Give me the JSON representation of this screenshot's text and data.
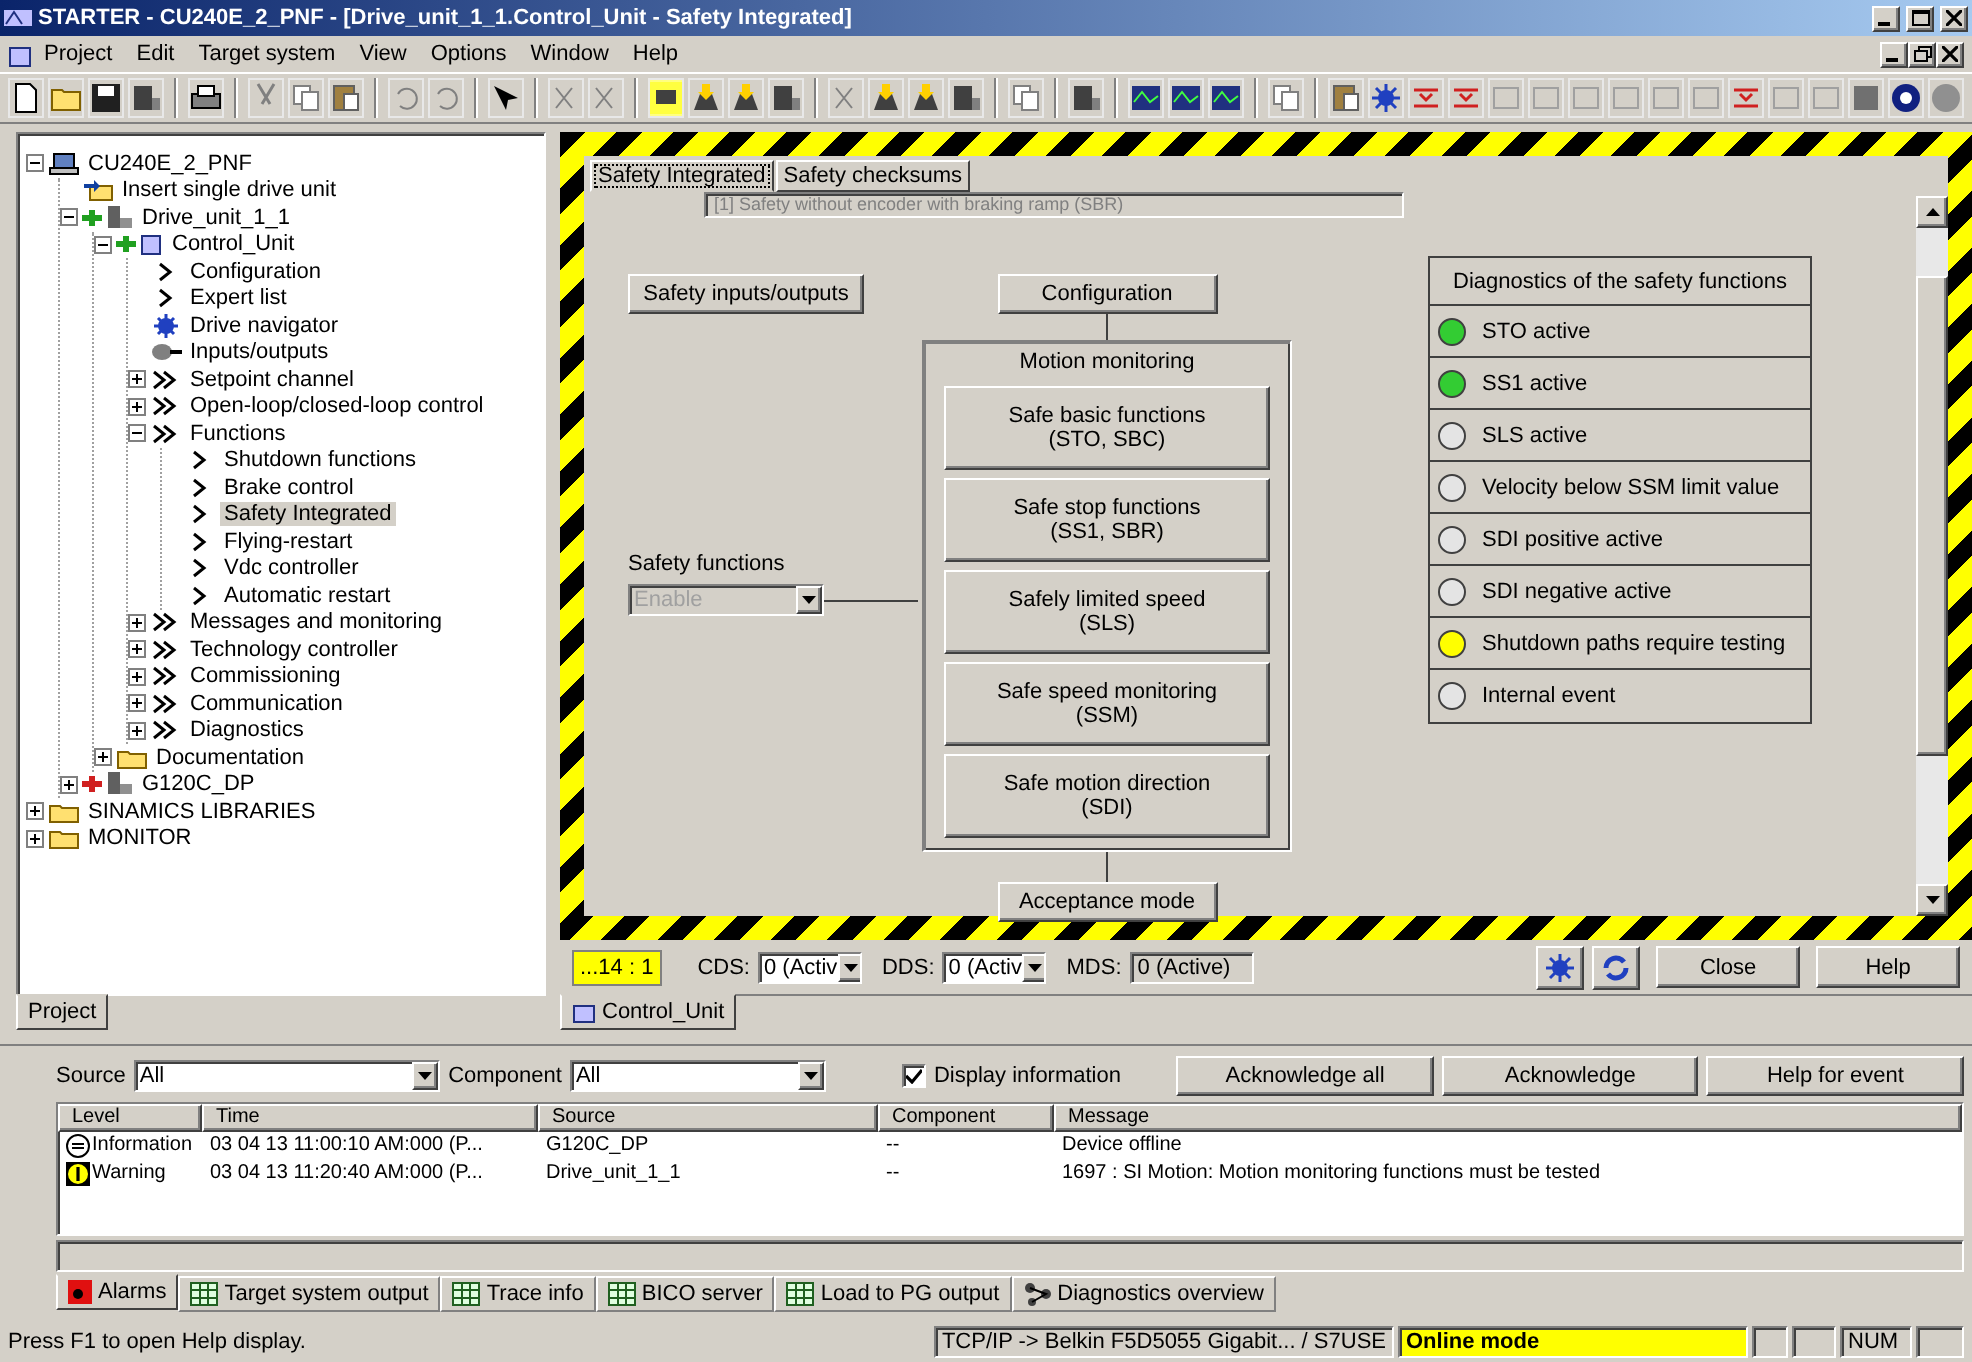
{
  "window": {
    "title": "STARTER - CU240E_2_PNF - [Drive_unit_1_1.Control_Unit - Safety Integrated]"
  },
  "menu": [
    "Project",
    "Edit",
    "Target system",
    "View",
    "Options",
    "Window",
    "Help"
  ],
  "project_tree": {
    "items": [
      {
        "label": "CU240E_2_PNF",
        "kind": "computer",
        "expanded": true,
        "selected": false,
        "children": [
          {
            "label": "Insert single drive unit",
            "kind": "insert",
            "selected": false
          },
          {
            "label": "Drive_unit_1_1",
            "kind": "drive",
            "expanded": true,
            "selected": false,
            "children": [
              {
                "label": "Control_Unit",
                "kind": "control",
                "expanded": true,
                "selected": false,
                "children": [
                  {
                    "label": "Configuration",
                    "kind": "arrow",
                    "selected": false
                  },
                  {
                    "label": "Expert list",
                    "kind": "arrow",
                    "selected": false
                  },
                  {
                    "label": "Drive navigator",
                    "kind": "navigator",
                    "selected": false
                  },
                  {
                    "label": "Inputs/outputs",
                    "kind": "io",
                    "selected": false
                  },
                  {
                    "label": "Setpoint channel",
                    "kind": "double",
                    "expanded": false,
                    "selected": false
                  },
                  {
                    "label": "Open-loop/closed-loop control",
                    "kind": "double",
                    "expanded": false,
                    "selected": false
                  },
                  {
                    "label": "Functions",
                    "kind": "double",
                    "expanded": true,
                    "selected": false,
                    "children": [
                      {
                        "label": "Shutdown functions",
                        "kind": "arrow",
                        "selected": false
                      },
                      {
                        "label": "Brake control",
                        "kind": "arrow",
                        "selected": false
                      },
                      {
                        "label": "Safety Integrated",
                        "kind": "arrow",
                        "selected": true
                      },
                      {
                        "label": "Flying-restart",
                        "kind": "arrow",
                        "selected": false
                      },
                      {
                        "label": "Vdc controller",
                        "kind": "arrow",
                        "selected": false
                      },
                      {
                        "label": "Automatic restart",
                        "kind": "arrow",
                        "selected": false
                      }
                    ]
                  },
                  {
                    "label": "Messages and monitoring",
                    "kind": "double",
                    "expanded": false,
                    "selected": false
                  },
                  {
                    "label": "Technology controller",
                    "kind": "double",
                    "expanded": false,
                    "selected": false
                  },
                  {
                    "label": "Commissioning",
                    "kind": "double",
                    "expanded": false,
                    "selected": false
                  },
                  {
                    "label": "Communication",
                    "kind": "double",
                    "expanded": false,
                    "selected": false
                  },
                  {
                    "label": "Diagnostics",
                    "kind": "double",
                    "expanded": false,
                    "selected": false
                  }
                ]
              },
              {
                "label": "Documentation",
                "kind": "folder",
                "expanded": false,
                "selected": false
              }
            ]
          },
          {
            "label": "G120C_DP",
            "kind": "drive_offline",
            "expanded": false,
            "selected": false
          }
        ]
      },
      {
        "label": "SINAMICS LIBRARIES",
        "kind": "folder",
        "expanded": false,
        "selected": false
      },
      {
        "label": "MONITOR",
        "kind": "folder",
        "expanded": false,
        "selected": false
      }
    ]
  },
  "project_tab": {
    "label": "Project",
    "selected": true
  },
  "editor": {
    "tabs": [
      {
        "label": "Safety Integrated",
        "selected": true
      },
      {
        "label": "Safety checksums",
        "selected": false
      }
    ],
    "mode_field": {
      "value": "[1] Safety without encoder with braking ramp (SBR)",
      "disabled": true
    },
    "io_button": "Safety inputs/outputs",
    "configuration_button": "Configuration",
    "safety_functions": {
      "label": "Safety functions",
      "value": "Enable",
      "disabled": true
    },
    "motion_monitoring": {
      "title": "Motion monitoring",
      "functions": [
        "Safe basic functions\n(STO, SBC)",
        "Safe stop functions\n(SS1, SBR)",
        "Safely limited speed\n(SLS)",
        "Safe speed monitoring\n(SSM)",
        "Safe motion direction\n(SDI)"
      ]
    },
    "acceptance_button": "Acceptance mode",
    "diagnostics": {
      "title": "Diagnostics of the safety functions",
      "items": [
        {
          "label": "STO active",
          "color": "#33cc33"
        },
        {
          "label": "SS1 active",
          "color": "#33cc33"
        },
        {
          "label": "SLS active",
          "color": "#e4e4e4"
        },
        {
          "label": "Velocity below SSM limit value",
          "color": "#e4e4e4"
        },
        {
          "label": "SDI positive active",
          "color": "#e4e4e4"
        },
        {
          "label": "SDI negative active",
          "color": "#e4e4e4"
        },
        {
          "label": "Shutdown paths require testing",
          "color": "#ffff00"
        },
        {
          "label": "Internal event",
          "color": "#e4e4e4"
        }
      ]
    }
  },
  "footer": {
    "counter": "...14 : 1",
    "cds": {
      "label": "CDS:",
      "value": "0 (Activ"
    },
    "dds": {
      "label": "DDS:",
      "value": "0 (Activ"
    },
    "mds": {
      "label": "MDS:",
      "value": "0 (Active)"
    },
    "buttons": [
      "Close",
      "Help"
    ]
  },
  "document_tab": {
    "label": "Control_Unit"
  },
  "alarms": {
    "source": {
      "label": "Source",
      "value": "All"
    },
    "component": {
      "label": "Component",
      "value": "All"
    },
    "display_information": {
      "label": "Display information",
      "checked": true
    },
    "buttons": [
      "Acknowledge all",
      "Acknowledge",
      "Help for event"
    ],
    "columns": [
      "Level",
      "Time",
      "Source",
      "Component",
      "Message"
    ],
    "rows": [
      {
        "kind": "information",
        "cells": [
          "Information",
          "03 04 13   11:00:10 AM:000 (P...",
          "G120C_DP",
          "--",
          "Device offline"
        ]
      },
      {
        "kind": "warning",
        "cells": [
          "Warning",
          "03 04 13   11:20:40 AM:000 (P...",
          "Drive_unit_1_1",
          "--",
          "1697 : SI Motion: Motion monitoring functions must be tested"
        ]
      }
    ],
    "tabs": [
      {
        "label": "Alarms",
        "kind": "alarm",
        "selected": true
      },
      {
        "label": "Target system output",
        "kind": "table",
        "selected": false
      },
      {
        "label": "Trace info",
        "kind": "table",
        "selected": false
      },
      {
        "label": "BICO server",
        "kind": "table",
        "selected": false
      },
      {
        "label": "Load to PG output",
        "kind": "table",
        "selected": false
      },
      {
        "label": "Diagnostics overview",
        "kind": "network",
        "selected": false
      }
    ]
  },
  "status_bar": {
    "hint": "Press F1 to open Help display.",
    "connection": "TCP/IP -> Belkin F5D5055 Gigabit... / S7USE",
    "mode": "Online mode",
    "num": "NUM"
  }
}
